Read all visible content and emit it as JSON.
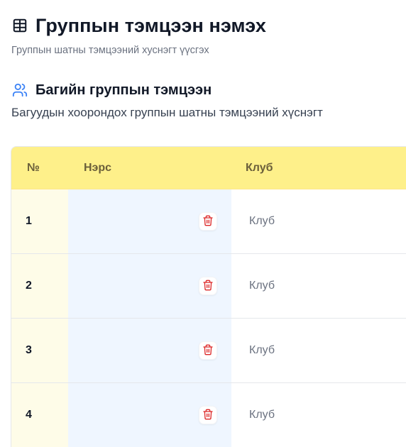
{
  "header": {
    "title": "Группын тэмцээн нэмэх",
    "subtitle": "Группын шатны тэмцээний хуснэгт үүсгэх",
    "icon": "table-icon"
  },
  "section": {
    "title": "Багийн группын тэмцээн",
    "description": "Багуудын хоорондох группын шатны тэмцээний хүснэгт",
    "icon": "users-icon"
  },
  "table": {
    "columns": [
      "№",
      "Нэрс",
      "Клуб"
    ],
    "rows": [
      {
        "number": "1",
        "name": "",
        "club_placeholder": "Клуб"
      },
      {
        "number": "2",
        "name": "",
        "club_placeholder": "Клуб"
      },
      {
        "number": "3",
        "name": "",
        "club_placeholder": "Клуб"
      },
      {
        "number": "4",
        "name": "",
        "club_placeholder": "Клуб"
      }
    ]
  },
  "colors": {
    "header_bg": "#fef08a",
    "number_col_bg": "#fefce8",
    "name_col_bg": "#eff6ff",
    "accent_blue": "#3b82f6",
    "delete_red": "#dc2626"
  }
}
